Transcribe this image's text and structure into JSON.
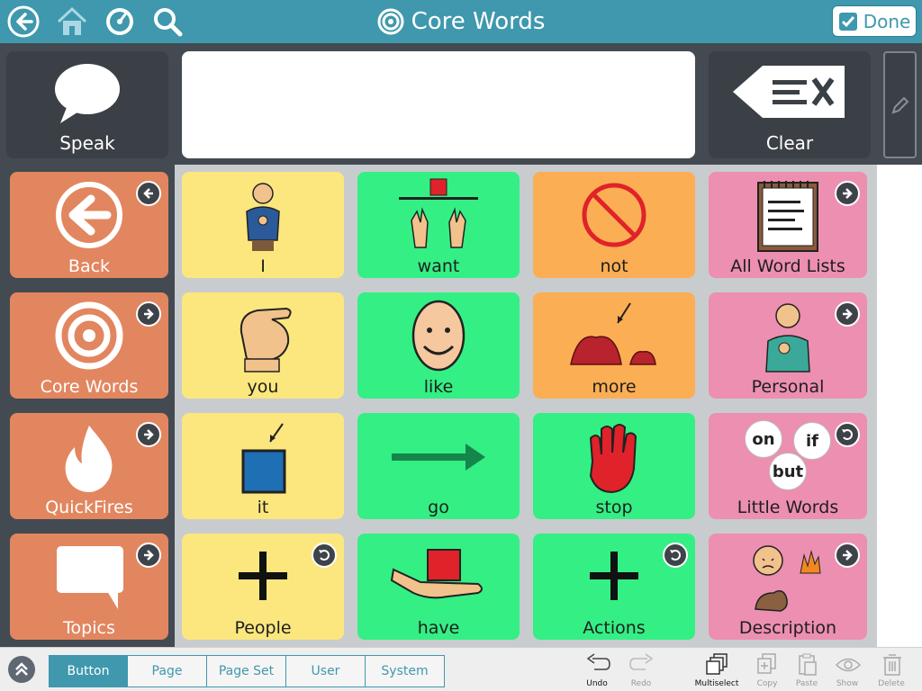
{
  "header": {
    "title": "Core Words",
    "done_label": "Done",
    "back_icon": "back-arrow-icon",
    "home_icon": "home-icon",
    "dashboard_icon": "speedometer-icon",
    "search_icon": "search-icon"
  },
  "top": {
    "speak_label": "Speak",
    "clear_label": "Clear",
    "message_text": ""
  },
  "sidebar": [
    {
      "label": "Back",
      "badge": "arrow-left"
    },
    {
      "label": "Core Words",
      "badge": "arrow-right"
    },
    {
      "label": "QuickFires",
      "badge": "arrow-right"
    },
    {
      "label": "Topics",
      "badge": "arrow-right"
    }
  ],
  "grid": {
    "row1": [
      "I",
      "want",
      "not",
      "All Word Lists"
    ],
    "row2": [
      "you",
      "like",
      "more",
      "Personal"
    ],
    "row3": [
      "it",
      "go",
      "stop",
      "Little Words"
    ],
    "row4": [
      "People",
      "have",
      "Actions",
      "Description"
    ]
  },
  "little_words_bubbles": [
    "on",
    "if",
    "but"
  ],
  "bottom": {
    "tabs": [
      "Button",
      "Page",
      "Page Set",
      "User",
      "System"
    ],
    "active_tab": "Button",
    "tools": [
      "Undo",
      "Redo",
      "Multiselect",
      "Copy",
      "Paste",
      "Show",
      "Delete"
    ]
  },
  "colors": {
    "header": "#3f98ad",
    "pronoun": "#fbe77e",
    "verb": "#34ef84",
    "adverb": "#fbae53",
    "folder": "#ec8fb1",
    "nav": "#e2865f"
  }
}
